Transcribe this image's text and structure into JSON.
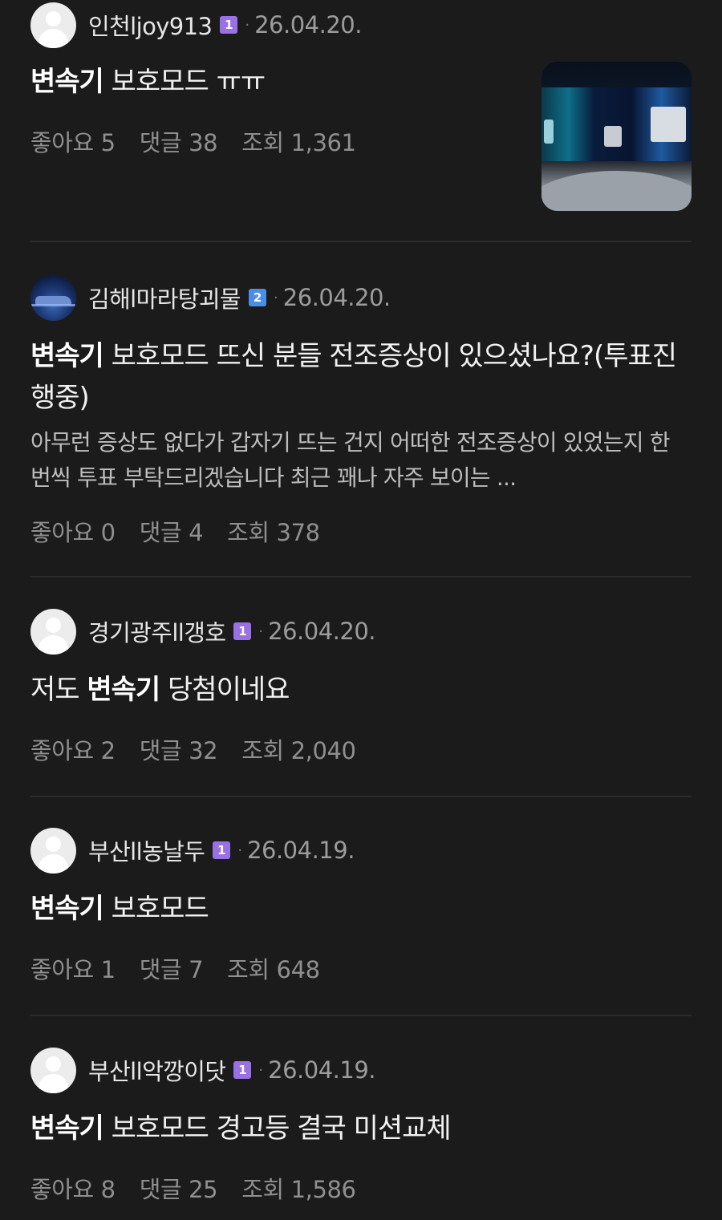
{
  "posts": [
    {
      "author": "인천ljoy913",
      "level": "1",
      "date": "26.04.20.",
      "title_keyword": "변속기",
      "title_rest": " 보호모드 ㅠㅠ",
      "excerpt": "",
      "likes_label": "좋아요 5",
      "comments_label": "댓글 38",
      "views_label": "조회 1,361",
      "has_thumbnail": true
    },
    {
      "author": "김해l마라탕괴물",
      "level": "2",
      "date": "26.04.20.",
      "title_keyword": "변속기",
      "title_rest": " 보호모드 뜨신 분들 전조증상이 있으셨나요?(투표진행중)",
      "excerpt": "아무런 증상도 없다가 갑자기 뜨는 건지 어떠한 전조증상이 있었는지 한 번씩 투표 부탁드리겠습니다 최근 꽤나 자주 보이는 ...",
      "likes_label": "좋아요 0",
      "comments_label": "댓글 4",
      "views_label": "조회 378",
      "has_thumbnail": false
    },
    {
      "author": "경기광주ll갱호",
      "level": "1",
      "date": "26.04.20.",
      "title_prefix": "저도 ",
      "title_keyword": "변속기",
      "title_rest": " 당첨이네요",
      "excerpt": "",
      "likes_label": "좋아요 2",
      "comments_label": "댓글 32",
      "views_label": "조회 2,040",
      "has_thumbnail": false
    },
    {
      "author": "부산ll농날두",
      "level": "1",
      "date": "26.04.19.",
      "title_keyword": "변속기",
      "title_rest": " 보호모드",
      "excerpt": "",
      "likes_label": "좋아요 1",
      "comments_label": "댓글 7",
      "views_label": "조회 648",
      "has_thumbnail": false
    },
    {
      "author": "부산ll악깡이닷",
      "level": "1",
      "date": "26.04.19.",
      "title_keyword": "변속기",
      "title_rest": " 보호모드 경고등 결국 미션교체",
      "excerpt": "",
      "likes_label": "좋아요 8",
      "comments_label": "댓글 25",
      "views_label": "조회 1,586",
      "has_thumbnail": false
    }
  ],
  "separator": "·",
  "colors": {
    "background": "#1b1b1c",
    "level1": "#9a71e4",
    "level2": "#4a8ee8",
    "meta_text": "#8f8f8f"
  }
}
